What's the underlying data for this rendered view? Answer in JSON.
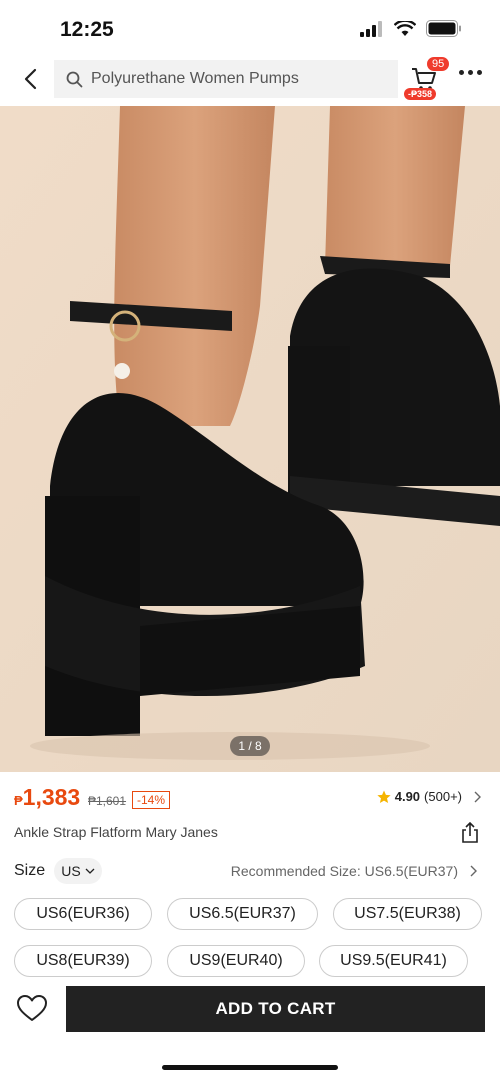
{
  "status": {
    "time": "12:25"
  },
  "header": {
    "search_text": "Polyurethane Women Pumps",
    "cart_badge": "95",
    "cart_coupon": "-₱358"
  },
  "gallery": {
    "counter": "1 / 8"
  },
  "product": {
    "currency": "₱",
    "price": "1,383",
    "original_price": "₱1,601",
    "discount": "-14%",
    "rating": "4.90",
    "review_count": "(500+)",
    "title": "Ankle Strap Flatform Mary Janes"
  },
  "size": {
    "label": "Size",
    "region": "US",
    "recommended": "Recommended Size: US6.5(EUR37)",
    "options": [
      "US6(EUR36)",
      "US6.5(EUR37)",
      "US7.5(EUR38)",
      "US8(EUR39)",
      "US9(EUR40)",
      "US9.5(EUR41)"
    ]
  },
  "actions": {
    "add_to_cart": "ADD TO CART"
  },
  "colors": {
    "price": "#e8490f",
    "badge": "#ef3b2c",
    "button": "#222222",
    "star": "#f5b400"
  }
}
